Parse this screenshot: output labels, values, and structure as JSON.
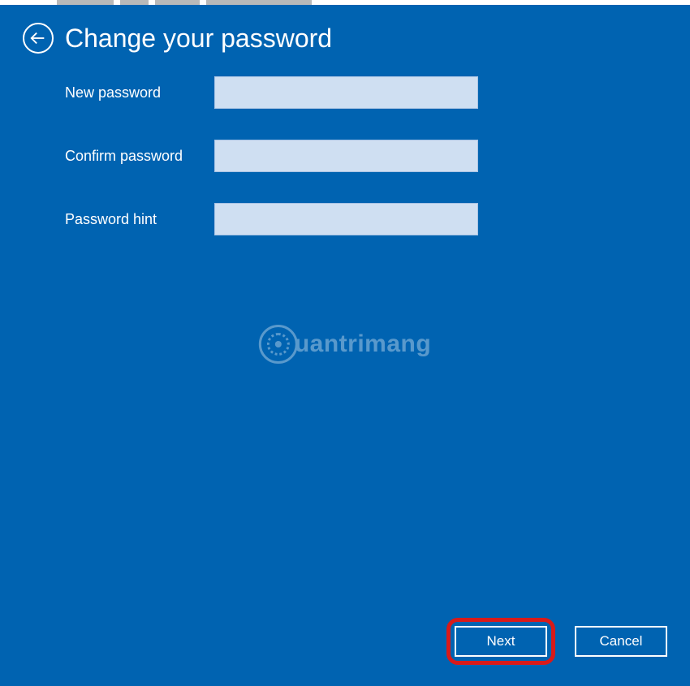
{
  "header": {
    "title": "Change your password"
  },
  "form": {
    "new_password_label": "New password",
    "new_password_value": "",
    "confirm_password_label": "Confirm password",
    "confirm_password_value": "",
    "password_hint_label": "Password hint",
    "password_hint_value": ""
  },
  "watermark": {
    "text": "uantrimang"
  },
  "footer": {
    "next_label": "Next",
    "cancel_label": "Cancel"
  }
}
